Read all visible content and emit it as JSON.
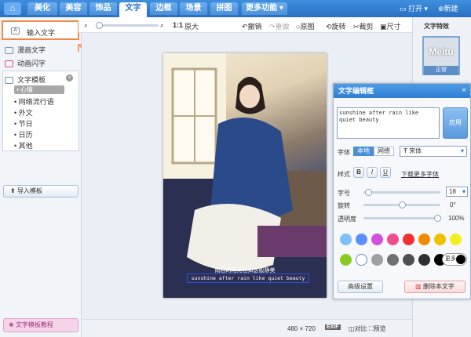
{
  "nav": {
    "tabs": [
      "美化",
      "美容",
      "饰品",
      "文字",
      "边框",
      "场景",
      "拼图",
      "更多功能 ▾"
    ],
    "active": "文字",
    "open_label": "打开",
    "new_label": "新建"
  },
  "toolbar": {
    "zoom_label": "1:1",
    "original_size": "原大",
    "undo": "撤销",
    "redo": "重做",
    "original": "原图",
    "rotate": "旋转",
    "crop": "裁剪",
    "size": "尺寸"
  },
  "left": {
    "items": [
      "输入文字",
      "漫画文字",
      "动画闪字",
      "文字模板"
    ],
    "subitems": [
      "心情",
      "网络流行语",
      "外文",
      "节日",
      "日历",
      "其他"
    ],
    "selected_sub": "心情",
    "import_label": "导入模板",
    "tutorial_label": "文字模板教程"
  },
  "right": {
    "title": "文字特效",
    "preview_text": "Meitu",
    "preview_caption": "正常"
  },
  "canvas": {
    "caption_line1": "雨后的阳光也如这般静美",
    "caption_line2": "sunshine after rain like quiet beauty"
  },
  "dialog": {
    "title": "文字编辑框",
    "text_value": "sunshine after rain like quiet beauty",
    "apply": "应用",
    "font_label": "字体",
    "local_tab": "本地",
    "web_tab": "网络",
    "font_name": "宋体",
    "style_label": "样式",
    "bold": "B",
    "italic": "I",
    "underline": "U",
    "download_more": "下载更多字体",
    "size_label": "字号",
    "size_value": "18",
    "rotate_label": "旋转",
    "rotate_value": "0°",
    "opacity_label": "透明度",
    "opacity_value": "100%",
    "more_colors": "更多",
    "advanced": "高级设置",
    "delete": "删除本文字",
    "colors": [
      "#7fbfff",
      "#5f8fff",
      "#d24fe0",
      "#f04c8c",
      "#f03030",
      "#f08a00",
      "#f0c000",
      "#f0f020",
      "#88cc22",
      "#ffffff",
      "#a0a0a0",
      "#707070",
      "#505050",
      "#303030",
      "#000000"
    ]
  },
  "status": {
    "dimensions": "480 × 720",
    "exif": "EXIF",
    "compare": "对比",
    "preview": "预览"
  }
}
